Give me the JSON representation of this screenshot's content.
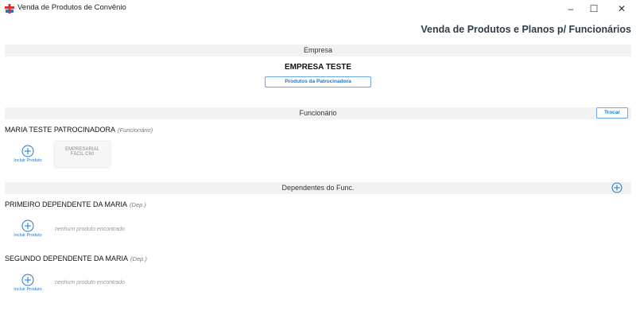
{
  "window": {
    "title": "Venda de Produtos de Convênio",
    "controls": {
      "minimize": "–",
      "maximize": "☐",
      "close": "✕"
    }
  },
  "header": {
    "title": "Venda de Produtos e Planos p/ Funcionários"
  },
  "empresa": {
    "section_label": "Empresa",
    "name": "EMPRESA TESTE",
    "products_button": "Produtos da Patrocinadora"
  },
  "funcionario": {
    "section_label": "Funcionário",
    "swap_button": "Trocar",
    "name": "MARIA TESTE PATROCINADORA",
    "role": "(Funcionário)",
    "add_product_label": "Incluir Produto",
    "products": [
      {
        "line1": "EMPRESARIAL",
        "line2": "FÁCIL C60"
      }
    ]
  },
  "dependentes": {
    "section_label": "Dependentes do Func.",
    "items": [
      {
        "name": "PRIMEIRO DEPENDENTE DA MARIA",
        "role": "(Dep.)",
        "add_product_label": "Incluir Produto",
        "empty_message": "nenhum produto encontrado"
      },
      {
        "name": "SEGUNDO DEPENDENTE DA MARIA",
        "role": "(Dep.)",
        "add_product_label": "Incluir Produto",
        "empty_message": "nenhum produto encontrado"
      }
    ]
  },
  "colors": {
    "accent": "#1e76d0",
    "band": "#f2f2f2",
    "header_text": "#2f3b48"
  }
}
